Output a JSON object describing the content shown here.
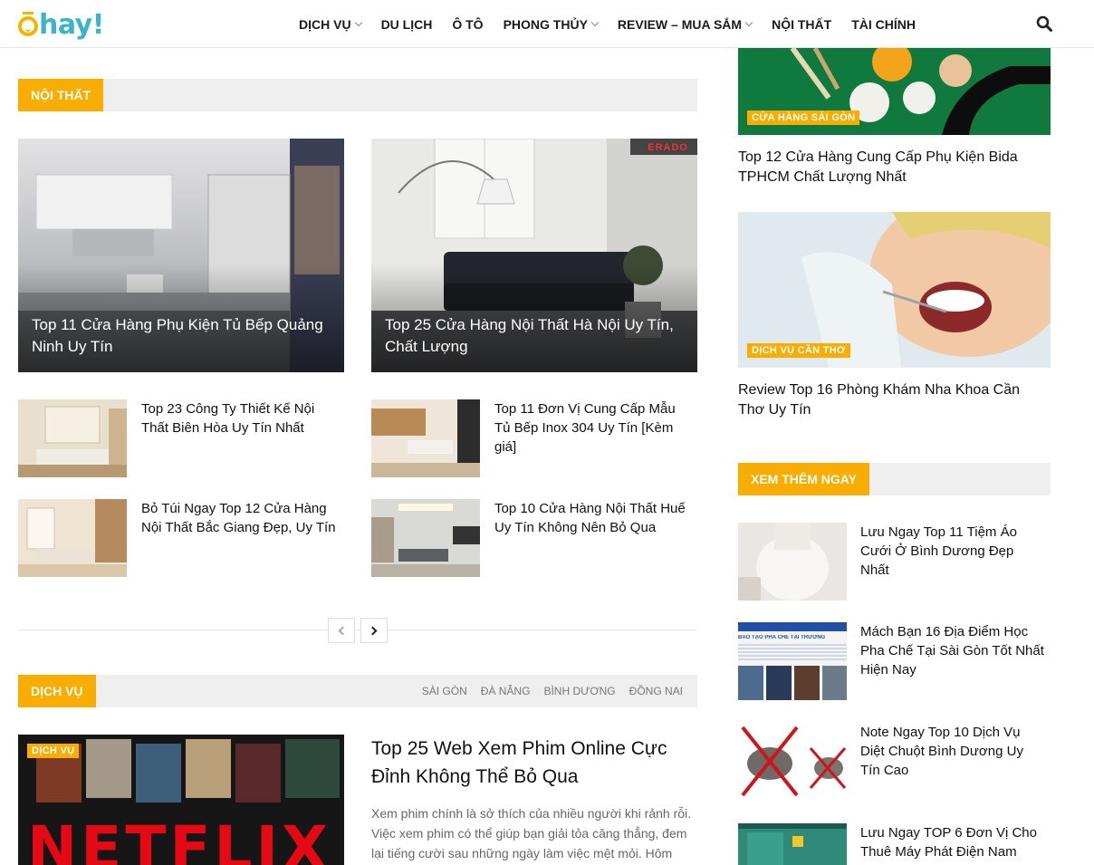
{
  "header": {
    "logo_text": "hay!",
    "nav": [
      {
        "label": "DỊCH VỤ",
        "has_dropdown": true
      },
      {
        "label": "DU LỊCH",
        "has_dropdown": false
      },
      {
        "label": "Ô TÔ",
        "has_dropdown": false
      },
      {
        "label": "PHONG THỦY",
        "has_dropdown": true
      },
      {
        "label": "REVIEW – MUA SẮM",
        "has_dropdown": true
      },
      {
        "label": "NỘI THẤT",
        "has_dropdown": false
      },
      {
        "label": "TÀI CHÍNH",
        "has_dropdown": false
      }
    ],
    "search_icon": "search-icon"
  },
  "noi_that": {
    "label": "NỘI THẤT",
    "big": [
      {
        "title": "Top 11 Cửa Hàng Phụ Kiện Tủ Bếp Quảng Ninh Uy Tín"
      },
      {
        "title": "Top 25 Cửa Hàng Nội Thất Hà Nội Uy Tín, Chất Lượng",
        "watermark": "ERADO"
      }
    ],
    "small": [
      {
        "title": "Top 23 Công Ty Thiết Kế Nội Thất Biên Hòa Uy Tín Nhất"
      },
      {
        "title": "Top 11 Đơn Vị Cung Cấp Mẫu Tủ Bếp Inox 304 Uy Tín [Kèm giá]"
      },
      {
        "title": "Bỏ Túi Ngay Top 12 Cửa Hàng Nội Thất Bắc Giang Đẹp, Uy Tín"
      },
      {
        "title": "Top 10 Cửa Hàng Nội Thất Huế Uy Tín Không Nên Bỏ Qua"
      }
    ]
  },
  "dich_vu": {
    "label": "DỊCH VỤ",
    "tabs": [
      "SÀI GÒN",
      "ĐÀ NẴNG",
      "BÌNH DƯƠNG",
      "ĐỒNG NAI"
    ],
    "feature": {
      "badge": "DỊCH VỤ",
      "image_text": "NETFLIX",
      "title": "Top 25 Web Xem Phim Online Cực Đỉnh Không Thể Bỏ Qua",
      "excerpt": "Xem phim chính là sở thích của nhiều người khi rảnh rỗi. Việc xem phim có thể giúp bạn giải tỏa căng thẳng, đem lại tiếng cười sau những ngày làm việc mệt mỏi. Hôm"
    }
  },
  "sidebar": {
    "top_posts": [
      {
        "badge": "CỬA HÀNG SÀI GÒN",
        "title": "Top 12 Cửa Hàng Cung Cấp Phụ Kiện Bida TPHCM Chất Lượng Nhất"
      },
      {
        "badge": "DỊCH VỤ CẦN THƠ",
        "title": "Review Top 16 Phòng Khám Nha Khoa Cần Thơ Uy Tín"
      }
    ],
    "more_label": "XEM THÊM NGAY",
    "more": [
      {
        "title": "Lưu Ngay Top 11 Tiệm Áo Cưới Ở Bình Dương Đẹp Nhất"
      },
      {
        "title": "Mách Bạn 16 Địa Điểm Học Pha Chế Tại Sài Gòn Tốt Nhất Hiện Nay",
        "image_text": "ĐÀO TẠO PHA CHẾ TẠI TRƯỜNG"
      },
      {
        "title": "Note Ngay Top 10 Dịch Vụ Diệt Chuột Bình Dương Uy Tín Cao"
      },
      {
        "title": "Lưu Ngay TOP 6 Đơn Vị Cho Thuê Máy Phát Điện Nam"
      }
    ]
  },
  "colors": {
    "accent": "#f9ad00",
    "logo_teal": "#39b5c9",
    "section_bg": "#efefef"
  }
}
